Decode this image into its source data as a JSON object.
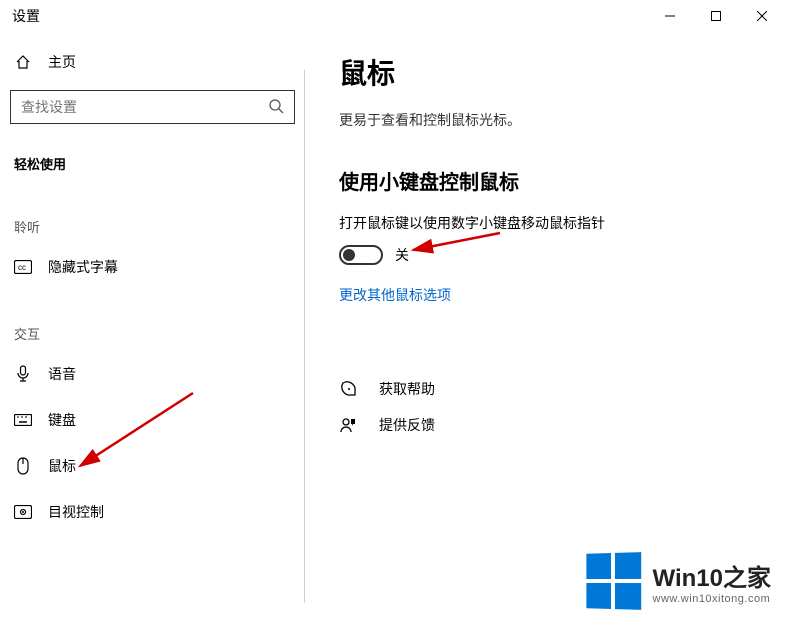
{
  "titlebar": {
    "title": "设置"
  },
  "sidebar": {
    "home_label": "主页",
    "search_placeholder": "查找设置",
    "section_title": "轻松使用",
    "group_listen": "聆听",
    "group_interact": "交互",
    "items": {
      "closed_captions": "隐藏式字幕",
      "speech": "语音",
      "keyboard": "键盘",
      "mouse": "鼠标",
      "eye_control": "目视控制"
    }
  },
  "content": {
    "title": "鼠标",
    "subtitle": "更易于查看和控制鼠标光标。",
    "section_heading": "使用小键盘控制鼠标",
    "toggle_label": "打开鼠标键以使用数字小键盘移动鼠标指针",
    "toggle_state": "关",
    "link_other": "更改其他鼠标选项",
    "help_label": "获取帮助",
    "feedback_label": "提供反馈"
  },
  "watermark": {
    "name": "Win10之家",
    "url": "www.win10xitong.com"
  }
}
